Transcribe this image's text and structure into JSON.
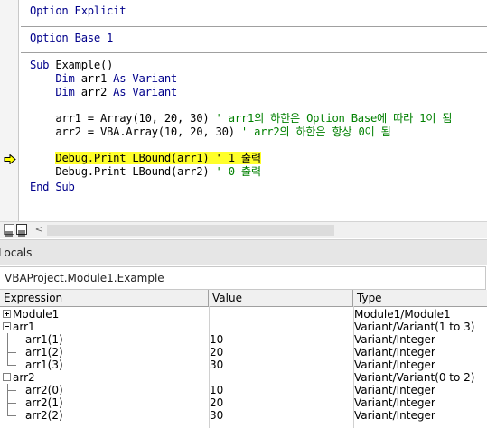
{
  "editor": {
    "lines": [
      [
        {
          "t": "Option Explicit",
          "k": "kw"
        }
      ],
      [
        {
          "t": "Option Base 1",
          "k": "kw"
        }
      ],
      [
        {
          "t": "Sub ",
          "k": "kw"
        },
        {
          "t": "Example()",
          "k": "tx"
        }
      ],
      [
        {
          "t": "    Dim ",
          "k": "kw"
        },
        {
          "t": "arr1 ",
          "k": "tx"
        },
        {
          "t": "As Variant",
          "k": "kw"
        }
      ],
      [
        {
          "t": "    Dim ",
          "k": "kw"
        },
        {
          "t": "arr2 ",
          "k": "tx"
        },
        {
          "t": "As Variant",
          "k": "kw"
        }
      ],
      [
        {
          "t": "    arr1 = Array(10, 20, 30) ",
          "k": "tx"
        },
        {
          "t": "' arr1의 하한은 Option Base에 따라 1이 됨",
          "k": "cm"
        }
      ],
      [
        {
          "t": "    arr2 = VBA.Array(10, 20, 30) ",
          "k": "tx"
        },
        {
          "t": "' arr2의 하한은 항상 0이 됨",
          "k": "cm"
        }
      ],
      [
        {
          "t": "    ",
          "k": "tx"
        },
        {
          "t": "Debug.Print LBound(arr1) ' 1 출력",
          "k": "hl"
        }
      ],
      [
        {
          "t": "    Debug.Print LBound(arr2) ",
          "k": "tx"
        },
        {
          "t": "' 0 출력",
          "k": "cm"
        }
      ],
      [
        {
          "t": "End Sub",
          "k": "kw"
        }
      ]
    ],
    "colors": {
      "keyword": "#00008b",
      "comment": "#008000",
      "highlight": "#ffff2a",
      "arrow": "#ffff00"
    }
  },
  "locals": {
    "title": "Locals",
    "context": "VBAProject.Module1.Example",
    "columns": {
      "expression": "Expression",
      "value": "Value",
      "type": "Type"
    },
    "rows": [
      {
        "expr": "Module1",
        "value": "",
        "type": "Module1/Module1",
        "node": "plus"
      },
      {
        "expr": "arr1",
        "value": "",
        "type": "Variant/Variant(1 to 3)",
        "node": "minus"
      },
      {
        "expr": "arr1(1)",
        "value": "10",
        "type": "Variant/Integer",
        "node": "child"
      },
      {
        "expr": "arr1(2)",
        "value": "20",
        "type": "Variant/Integer",
        "node": "child"
      },
      {
        "expr": "arr1(3)",
        "value": "30",
        "type": "Variant/Integer",
        "node": "child-last"
      },
      {
        "expr": "arr2",
        "value": "",
        "type": "Variant/Variant(0 to 2)",
        "node": "minus"
      },
      {
        "expr": "arr2(0)",
        "value": "10",
        "type": "Variant/Integer",
        "node": "child"
      },
      {
        "expr": "arr2(1)",
        "value": "20",
        "type": "Variant/Integer",
        "node": "child"
      },
      {
        "expr": "arr2(2)",
        "value": "30",
        "type": "Variant/Integer",
        "node": "child-last"
      }
    ]
  }
}
